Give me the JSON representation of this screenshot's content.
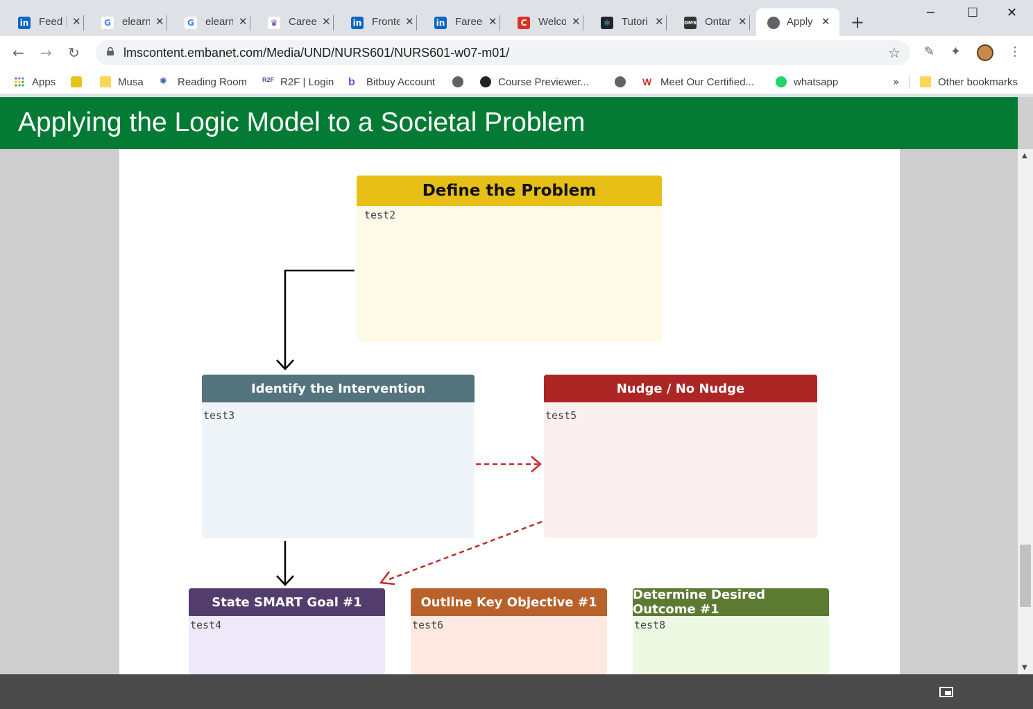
{
  "tabs": [
    {
      "title": "Feed |",
      "favicon": "linkedin-icon",
      "color": "#0a66c2"
    },
    {
      "title": "elearn",
      "favicon": "google-icon",
      "color": "#4285f4"
    },
    {
      "title": "elearn",
      "favicon": "google-icon",
      "color": "#4285f4"
    },
    {
      "title": "Careers",
      "favicon": "university-icon",
      "color": "#6a3d9a"
    },
    {
      "title": "Fronte",
      "favicon": "linkedin-icon",
      "color": "#0a66c2"
    },
    {
      "title": "Fareed",
      "favicon": "linkedin-icon",
      "color": "#0a66c2"
    },
    {
      "title": "Welco",
      "favicon": "c-icon",
      "color": "#d93025"
    },
    {
      "title": "Tutori",
      "favicon": "react-icon",
      "color": "#20232a"
    },
    {
      "title": "Ontar",
      "favicon": "dms-icon",
      "color": "#333333"
    },
    {
      "title": "Apply",
      "favicon": "globe-icon",
      "color": "#5f6368"
    }
  ],
  "toolbar": {
    "url": "lmscontent.embanet.com/Media/UND/NURS601/NURS601-w07-m01/"
  },
  "bookmarks": [
    {
      "label": "Apps",
      "icon": "apps-grid-icon"
    },
    {
      "label": "",
      "icon": "turtle-icon"
    },
    {
      "label": "Musa",
      "icon": "folder-icon"
    },
    {
      "label": "Reading Room",
      "icon": "reading-room-icon"
    },
    {
      "label": "R2F | Login",
      "icon": "r2f-icon"
    },
    {
      "label": "Bitbuy Account",
      "icon": "bitbuy-icon"
    },
    {
      "label": "",
      "icon": "globe-icon"
    },
    {
      "label": "Course Previewer...",
      "icon": "course-previewer-icon"
    },
    {
      "label": "",
      "icon": "globe-icon"
    },
    {
      "label": "Meet Our Certified...",
      "icon": "certified-icon"
    },
    {
      "label": "whatsapp",
      "icon": "whatsapp-icon"
    }
  ],
  "other_bookmarks": "Other bookmarks",
  "page": {
    "title": "Applying the Logic Model to a Societal Problem",
    "accent": "#037b34"
  },
  "cards": {
    "define": {
      "title": "Define the Problem",
      "text": "test2",
      "color": "#e8bf17"
    },
    "identify": {
      "title": "Identify the Intervention",
      "text": "test3",
      "color": "#53737d"
    },
    "nudge": {
      "title": "Nudge / No Nudge",
      "text": "test5",
      "color": "#ad2626"
    },
    "smart": {
      "title": "State SMART Goal #1",
      "text": "test4",
      "color": "#533d6d"
    },
    "outline": {
      "title": "Outline Key Objective #1",
      "text": "test6",
      "color": "#b9612a"
    },
    "desired": {
      "title": "Determine Desired Outcome #1",
      "text": "test8",
      "color": "#5d7a33"
    }
  }
}
